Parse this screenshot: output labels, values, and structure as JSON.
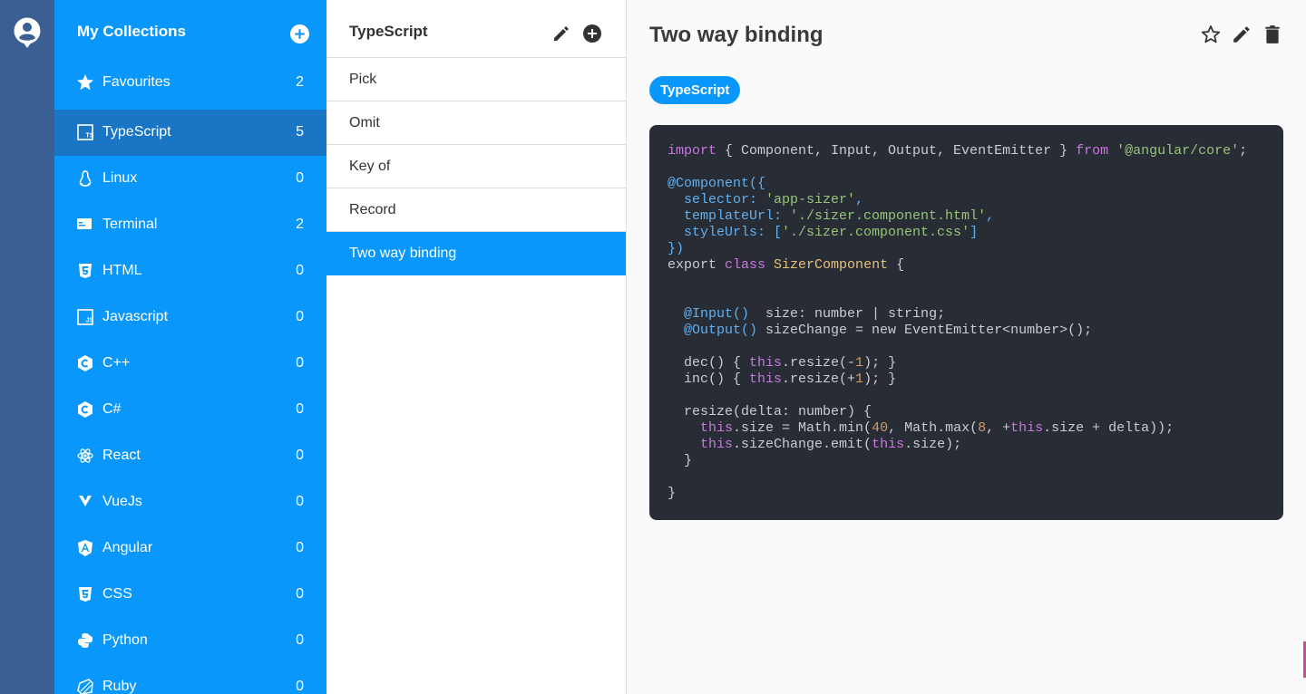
{
  "rail": {
    "avatar_icon": "user-circle-icon"
  },
  "collections": {
    "title": "My Collections",
    "add_icon": "plus-circle-icon",
    "accent": "#0a97fb",
    "active_bg": "#1a76c4",
    "items": [
      {
        "label": "Favourites",
        "count": "2",
        "icon": "star-icon"
      },
      {
        "label": "TypeScript",
        "count": "5",
        "icon": "typescript-icon"
      },
      {
        "label": "Linux",
        "count": "0",
        "icon": "linux-icon"
      },
      {
        "label": "Terminal",
        "count": "2",
        "icon": "terminal-icon"
      },
      {
        "label": "HTML",
        "count": "0",
        "icon": "html5-icon"
      },
      {
        "label": "Javascript",
        "count": "0",
        "icon": "javascript-icon"
      },
      {
        "label": "C++",
        "count": "0",
        "icon": "cplusplus-icon"
      },
      {
        "label": "C#",
        "count": "0",
        "icon": "csharp-icon"
      },
      {
        "label": "React",
        "count": "0",
        "icon": "react-icon"
      },
      {
        "label": "VueJs",
        "count": "0",
        "icon": "vue-icon"
      },
      {
        "label": "Angular",
        "count": "0",
        "icon": "angular-icon"
      },
      {
        "label": "CSS",
        "count": "0",
        "icon": "css3-icon"
      },
      {
        "label": "Python",
        "count": "0",
        "icon": "python-icon"
      },
      {
        "label": "Ruby",
        "count": "0",
        "icon": "ruby-icon"
      }
    ]
  },
  "snippets": {
    "title": "TypeScript",
    "edit_icon": "pencil-icon",
    "add_icon": "plus-circle-icon",
    "items": [
      {
        "label": "Pick"
      },
      {
        "label": "Omit"
      },
      {
        "label": "Key of"
      },
      {
        "label": "Record"
      },
      {
        "label": "Two way binding"
      }
    ]
  },
  "detail": {
    "title": "Two way binding",
    "tag": "TypeScript",
    "actions": [
      "star-outline-icon",
      "pencil-icon",
      "trash-icon"
    ],
    "code_lines": [
      "import { Component, Input, Output, EventEmitter } from '@angular/core';",
      "",
      "@Component({",
      "  selector: 'app-sizer',",
      "  templateUrl: './sizer.component.html',",
      "  styleUrls: ['./sizer.component.css']",
      "})",
      "export class SizerComponent {",
      "",
      "",
      "  @Input()  size: number | string;",
      "  @Output() sizeChange = new EventEmitter<number>();",
      "",
      "  dec() { this.resize(-1); }",
      "  inc() { this.resize(+1); }",
      "",
      "  resize(delta: number) {",
      "    this.size = Math.min(40, Math.max(8, +this.size + delta));",
      "    this.sizeChange.emit(this.size);",
      "  }",
      "",
      "}"
    ]
  }
}
